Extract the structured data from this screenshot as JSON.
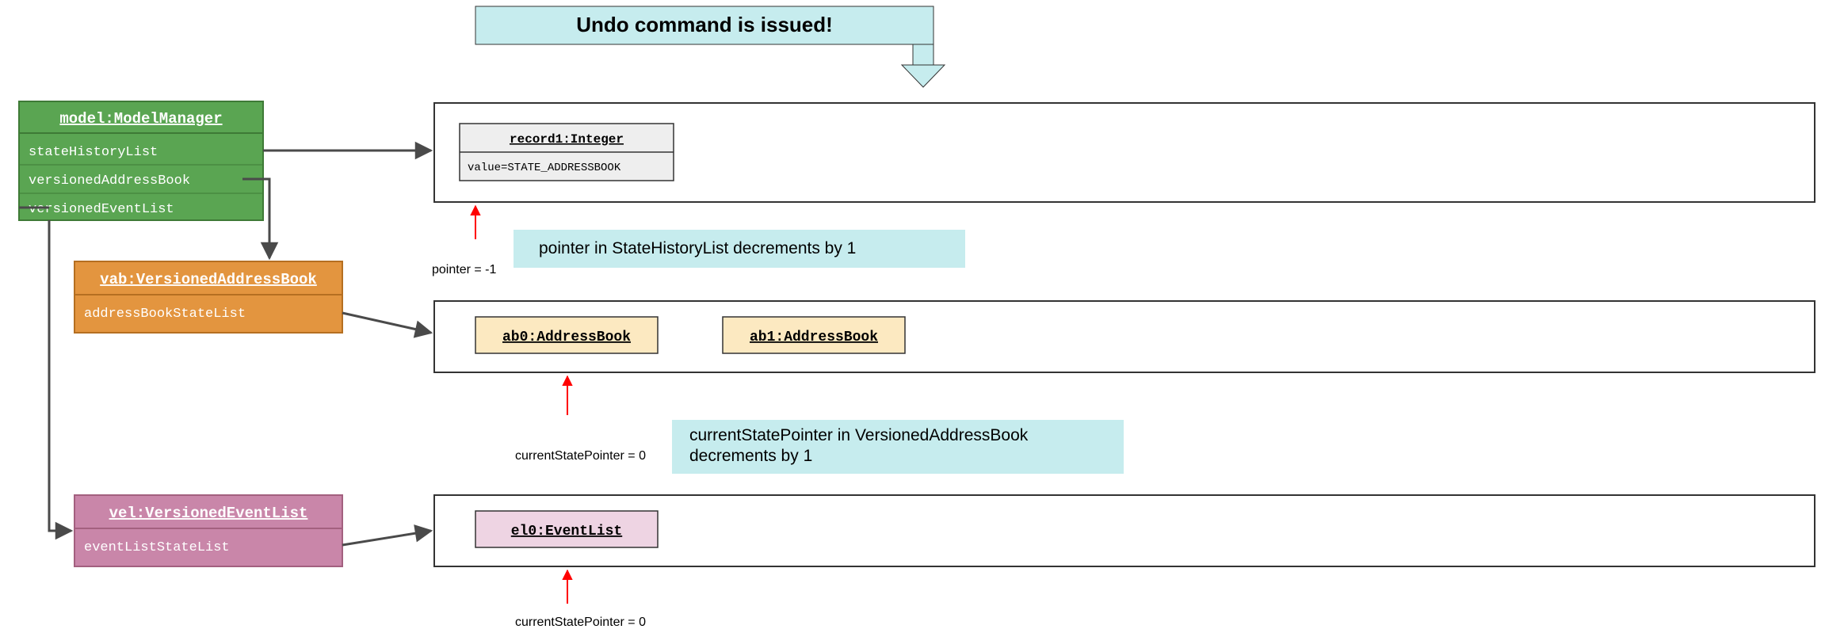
{
  "banner": {
    "text": "Undo command is issued!"
  },
  "model": {
    "title": "model:ModelManager",
    "attrs": [
      "stateHistoryList",
      "versionedAddressBook",
      "versionedEventList"
    ]
  },
  "vab": {
    "title": "vab:VersionedAddressBook",
    "attrs": [
      "addressBookStateList"
    ]
  },
  "vel": {
    "title": "vel:VersionedEventList",
    "attrs": [
      "eventListStateList"
    ]
  },
  "record": {
    "title": "record1:Integer",
    "value": "value=STATE_ADDRESSBOOK"
  },
  "ab0": {
    "title": "ab0:AddressBook"
  },
  "ab1": {
    "title": "ab1:AddressBook"
  },
  "el0": {
    "title": "el0:EventList"
  },
  "pointers": {
    "stateHistory": "pointer = -1",
    "addressBook": "currentStatePointer = 0",
    "eventList": "currentStatePointer = 0"
  },
  "callouts": {
    "shl": "pointer in StateHistoryList decrements by 1",
    "vab": "currentStatePointer in VersionedAddressBook decrements by 1"
  },
  "colors": {
    "cyan": "#c6ecee",
    "green": "#5aa552",
    "greenDark": "#3e7a36",
    "orange": "#e3953f",
    "orangeDark": "#b56f21",
    "pink": "#c986a9",
    "pinkDark": "#a3607f",
    "pinkLight": "#eed4e3",
    "cream": "#fce9c1",
    "grey": "#eeeeee",
    "stroke": "#333333",
    "arrow": "#4a4a4a",
    "red": "#ff0000"
  }
}
